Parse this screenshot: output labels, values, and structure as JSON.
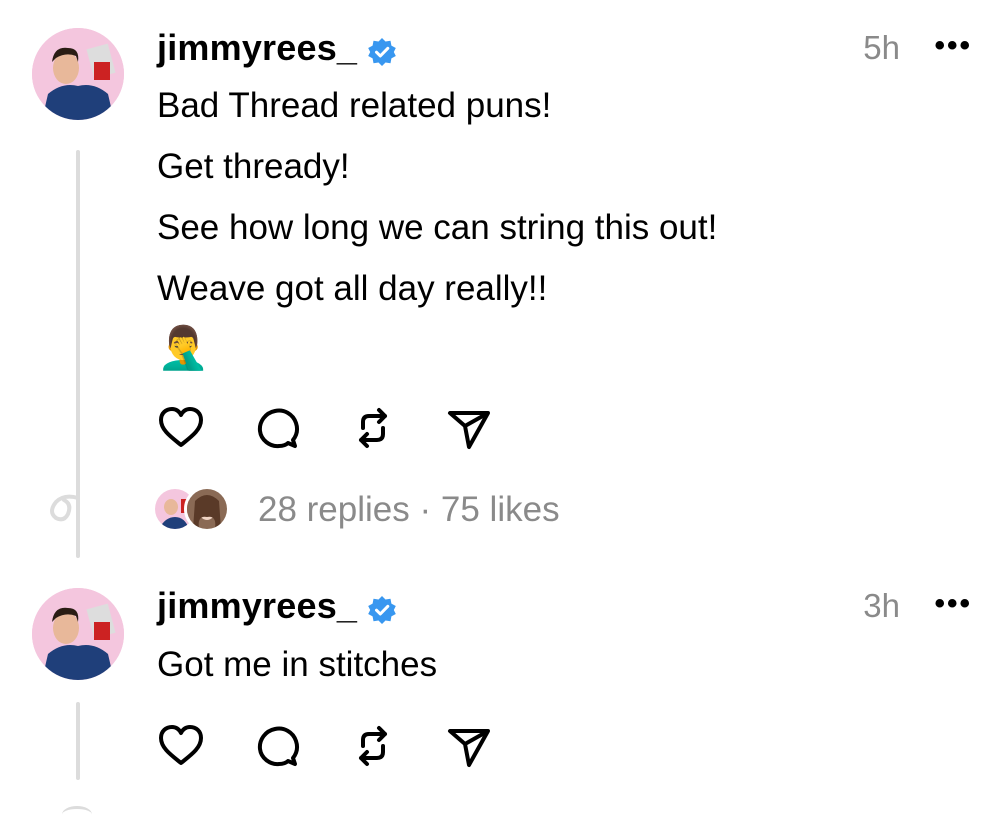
{
  "posts": [
    {
      "username": "jimmyrees_",
      "time": "5h",
      "more": "•••",
      "lines": [
        "Bad Thread related puns!",
        "Get thready!",
        "See how long we can string this out!",
        "Weave got all day really!!"
      ],
      "emoji": "🤦‍♂️",
      "replies": "28 replies",
      "separator": "·",
      "likes": "75 likes"
    },
    {
      "username": "jimmyrees_",
      "time": "3h",
      "more": "•••",
      "lines": [
        "Got me in stitches"
      ]
    }
  ],
  "icons": [
    "heart-icon",
    "comment-icon",
    "repost-icon",
    "share-icon"
  ],
  "colors": {
    "verified": "#3897f0",
    "muted": "#8a8a8a",
    "avatar_bg": "#f4c6de"
  }
}
